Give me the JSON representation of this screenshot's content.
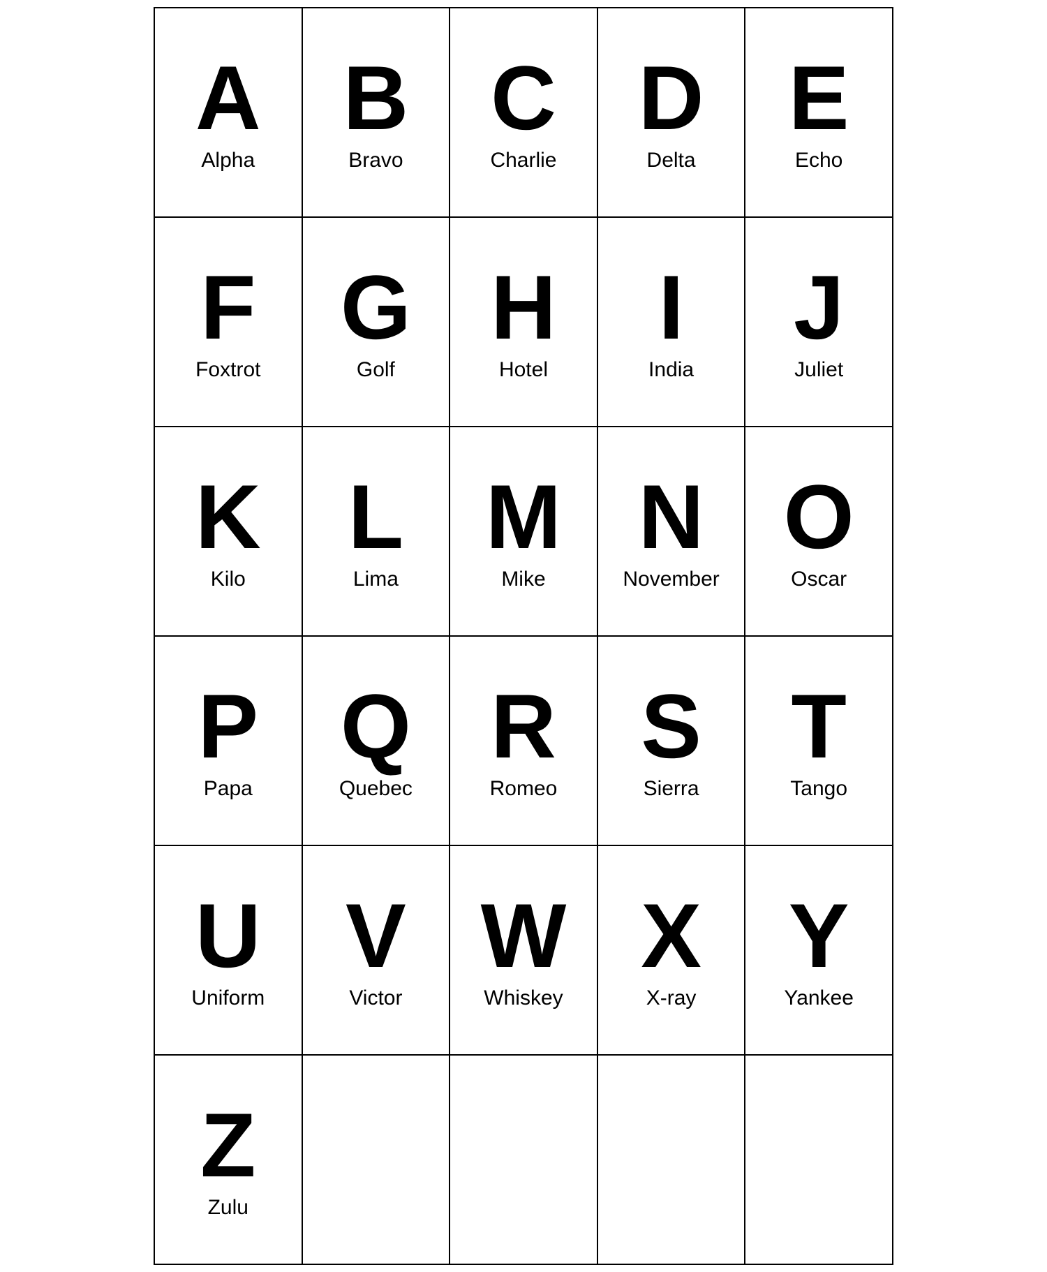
{
  "alphabet": [
    [
      {
        "letter": "A",
        "word": "Alpha"
      },
      {
        "letter": "B",
        "word": "Bravo"
      },
      {
        "letter": "C",
        "word": "Charlie"
      },
      {
        "letter": "D",
        "word": "Delta"
      },
      {
        "letter": "E",
        "word": "Echo"
      }
    ],
    [
      {
        "letter": "F",
        "word": "Foxtrot"
      },
      {
        "letter": "G",
        "word": "Golf"
      },
      {
        "letter": "H",
        "word": "Hotel"
      },
      {
        "letter": "I",
        "word": "India"
      },
      {
        "letter": "J",
        "word": "Juliet"
      }
    ],
    [
      {
        "letter": "K",
        "word": "Kilo"
      },
      {
        "letter": "L",
        "word": "Lima"
      },
      {
        "letter": "M",
        "word": "Mike"
      },
      {
        "letter": "N",
        "word": "November"
      },
      {
        "letter": "O",
        "word": "Oscar"
      }
    ],
    [
      {
        "letter": "P",
        "word": "Papa"
      },
      {
        "letter": "Q",
        "word": "Quebec"
      },
      {
        "letter": "R",
        "word": "Romeo"
      },
      {
        "letter": "S",
        "word": "Sierra"
      },
      {
        "letter": "T",
        "word": "Tango"
      }
    ],
    [
      {
        "letter": "U",
        "word": "Uniform"
      },
      {
        "letter": "V",
        "word": "Victor"
      },
      {
        "letter": "W",
        "word": "Whiskey"
      },
      {
        "letter": "X",
        "word": "X-ray"
      },
      {
        "letter": "Y",
        "word": "Yankee"
      }
    ],
    [
      {
        "letter": "Z",
        "word": "Zulu"
      },
      {
        "letter": "",
        "word": ""
      },
      {
        "letter": "",
        "word": ""
      },
      {
        "letter": "",
        "word": ""
      },
      {
        "letter": "",
        "word": ""
      }
    ]
  ]
}
